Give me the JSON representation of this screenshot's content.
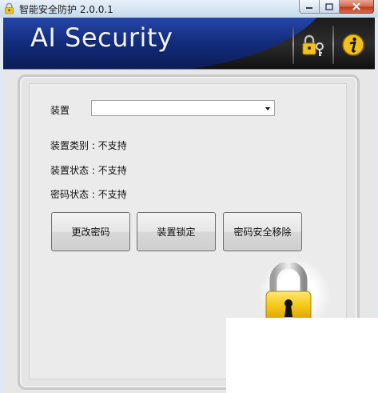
{
  "window": {
    "title": "智能安全防护 2.0.0.1",
    "controls": [
      "minimize",
      "maximize",
      "close"
    ]
  },
  "banner": {
    "title": "AI Security",
    "icons": [
      "keys-lock-icon",
      "info-icon"
    ]
  },
  "form": {
    "device_label": "装置",
    "device_select_value": "",
    "device_type": "装置类别 : 不支持",
    "device_status": "装置状态 : 不支持",
    "password_status": "密码状态 : 不支持"
  },
  "buttons": {
    "change_password": "更改密码",
    "lock_device": "装置锁定",
    "remove_password": "密码安全移除"
  },
  "colors": {
    "banner_blue": "#1a3b96",
    "banner_black": "#1b1b1b",
    "lock_gold": "#f2c21b"
  }
}
